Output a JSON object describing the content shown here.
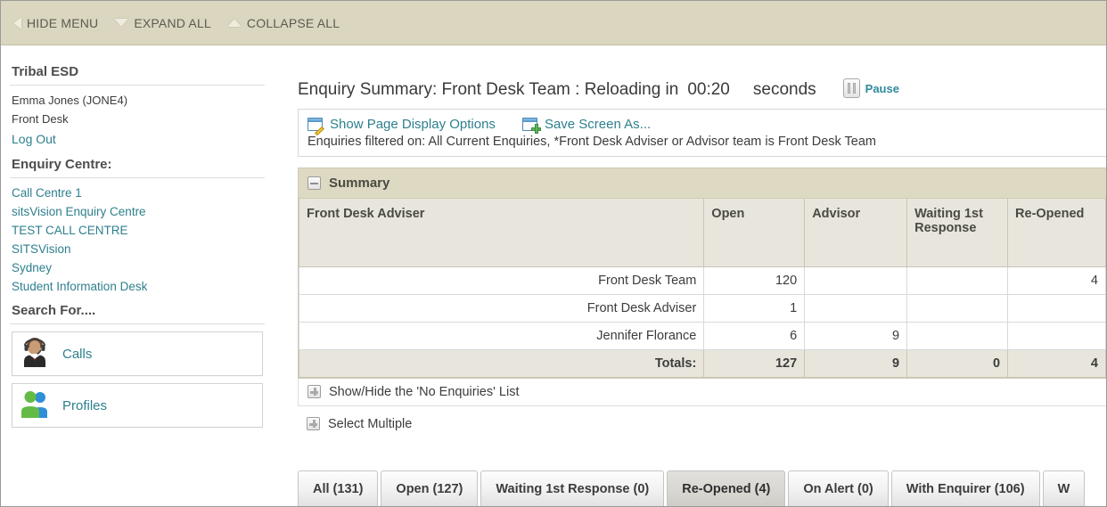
{
  "topbar": {
    "items": [
      {
        "label": "HIDE MENU",
        "icon": "triangle-left-icon"
      },
      {
        "label": "EXPAND ALL",
        "icon": "triangle-down-icon"
      },
      {
        "label": "COLLAPSE ALL",
        "icon": "triangle-up-icon"
      }
    ]
  },
  "sidebar": {
    "app_title": "Tribal ESD",
    "user_name": "Emma Jones (JONE4)",
    "user_team": "Front Desk",
    "logout_label": "Log Out",
    "enquiry_centre_heading": "Enquiry Centre:",
    "centres": [
      "Call Centre 1",
      "sitsVision Enquiry Centre",
      "TEST CALL CENTRE",
      "SITSVision",
      "Sydney",
      "Student Information Desk"
    ],
    "search_heading": "Search For....",
    "search_buttons": [
      {
        "label": "Calls",
        "icon": "headset-agent-icon"
      },
      {
        "label": "Profiles",
        "icon": "people-group-icon"
      }
    ]
  },
  "header": {
    "title": "Enquiry Summary: Front Desk Team : Reloading in",
    "countdown": "00:20",
    "seconds_label": "seconds",
    "pause_label": "Pause",
    "pause_icon": "pause-icon"
  },
  "toolbar": {
    "show_page_display_options": "Show Page Display Options",
    "show_page_display_options_icon": "window-pencil-icon",
    "save_screen_as": "Save Screen As...",
    "save_screen_as_icon": "window-plus-icon",
    "filter_text": "Enquiries filtered on: All Current Enquiries, *Front Desk Adviser or Advisor team is Front Desk Team"
  },
  "summary_panel": {
    "title": "Summary",
    "collapse_icon": "minus-box-icon",
    "columns": [
      "Front Desk Adviser",
      "Open",
      "Advisor",
      "Waiting 1st Response",
      "Re-Opened"
    ],
    "rows": [
      {
        "name": "Front Desk Team",
        "open": "120",
        "advisor": "",
        "waiting": "",
        "reopened": "4",
        "reopened_highlight": true
      },
      {
        "name": "Front Desk Adviser",
        "open": "1",
        "advisor": "",
        "waiting": "",
        "reopened": "",
        "reopened_highlight": false
      },
      {
        "name": "Jennifer Florance",
        "open": "6",
        "advisor": "9",
        "waiting": "",
        "reopened": "",
        "reopened_highlight": false
      }
    ],
    "totals": {
      "label": "Totals:",
      "open": "127",
      "advisor": "9",
      "waiting": "0",
      "reopened": "4"
    },
    "highlight_color": "#4dfa5c"
  },
  "below_table": {
    "show_hide_label": "Show/Hide the 'No Enquiries' List",
    "show_hide_icon": "expand-box-icon",
    "select_multiple_label": "Select Multiple",
    "select_multiple_icon": "expand-box-icon"
  },
  "tabs": {
    "active": "Re-Opened (4)",
    "items": [
      "All (131)",
      "Open (127)",
      "Waiting 1st Response (0)",
      "Re-Opened (4)",
      "On Alert (0)",
      "With Enquirer (106)",
      "W"
    ]
  },
  "colors": {
    "topbar_bg": "#dad6bf",
    "panel_header_bg": "#ddd9c2",
    "link": "#2e7f8e",
    "table_header_bg": "#e8e6dc"
  }
}
